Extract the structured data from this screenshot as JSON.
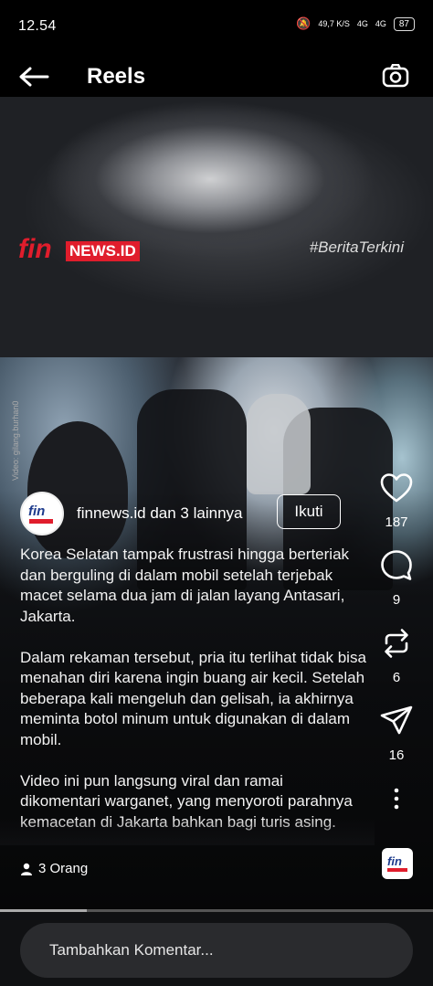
{
  "status_bar": {
    "time": "12.54",
    "speed": "49,7 K/S",
    "network1": "4G",
    "network2": "4G",
    "battery": "87"
  },
  "header": {
    "title": "Reels",
    "back_icon": "arrow-left-icon",
    "camera_icon": "camera-icon"
  },
  "video": {
    "logo_fin": "fin",
    "logo_news": "NEWS.ID",
    "hashtag": "#BeritaTerkini",
    "watermark": "Video: gilang.burhan0"
  },
  "post": {
    "author_name": "finnews.id",
    "author_connector": " dan ",
    "author_others": "3 lainnya",
    "follow_label": "Ikuti",
    "caption_paragraphs": [
      "Korea Selatan tampak frustrasi hingga berteriak dan berguling di dalam mobil setelah terjebak macet selama dua jam di jalan layang Antasari, Jakarta.",
      "Dalam rekaman tersebut, pria itu terlihat tidak bisa menahan diri karena ingin buang air kecil. Setelah beberapa kali mengeluh dan gelisah, ia akhirnya meminta botol minum untuk digunakan di dalam mobil.",
      "Video ini pun langsung viral dan ramai dikomentari warganet, yang menyoroti parahnya kemacetan di Jakarta bahkan bagi turis asing."
    ],
    "people_label": "3 Orang"
  },
  "actions": {
    "likes": "187",
    "comments": "9",
    "reposts": "6",
    "shares": "16"
  },
  "comment": {
    "placeholder": "Tambahkan Komentar..."
  },
  "progress": {
    "fraction": 0.2
  }
}
